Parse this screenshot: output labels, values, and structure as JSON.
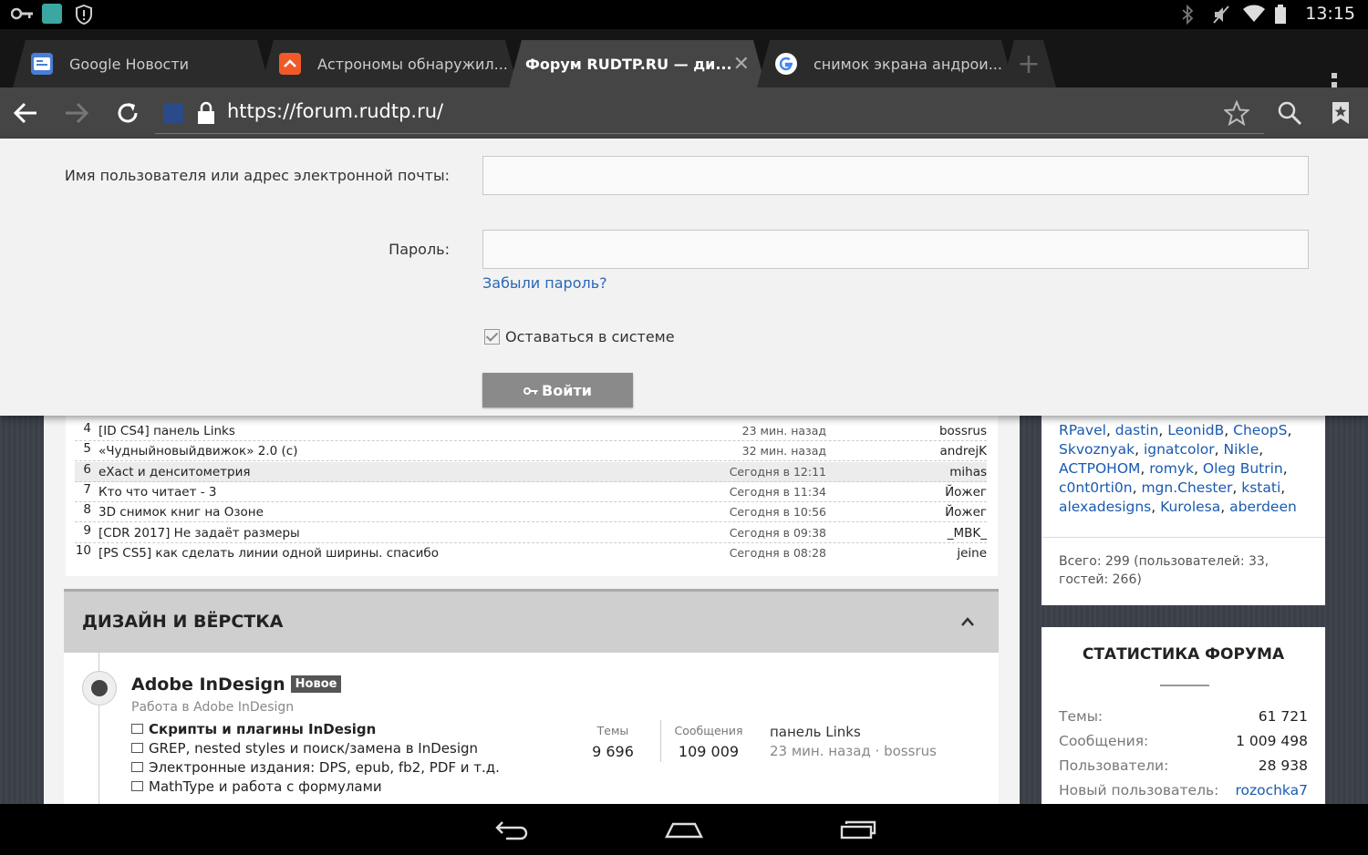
{
  "status_bar": {
    "time": "13:15",
    "left_icons": [
      "key-icon",
      "app-icon",
      "alert-icon"
    ],
    "right_icons": [
      "bluetooth-icon",
      "mute-icon",
      "wifi-icon",
      "battery-icon"
    ]
  },
  "tabs": [
    {
      "label": "Google Новости",
      "icon": "google-news-icon",
      "active": false
    },
    {
      "label": "Астрономы обнаружил...",
      "icon": "news-icon",
      "active": false
    },
    {
      "label": "Форум RUDTP.RU — ди...",
      "icon": "",
      "active": true
    },
    {
      "label": "снимок экрана андрои...",
      "icon": "google-icon",
      "active": false
    }
  ],
  "toolbar": {
    "url": "https://forum.rudtp.ru/"
  },
  "login": {
    "username_label": "Имя пользователя или адрес электронной почты:",
    "username_value": "",
    "password_label": "Пароль:",
    "password_value": "",
    "forgot_link": "Забыли пароль?",
    "remember_label": "Оставаться в системе",
    "remember_checked": true,
    "submit_label": "Войти"
  },
  "threads": [
    {
      "num": "4",
      "title": "[ID CS4]  панель Links",
      "time": "23 мин. назад",
      "user": "bossrus"
    },
    {
      "num": "5",
      "title": "«Чудныйновыйдвижок» 2.0 (с)",
      "time": "32 мин. назад",
      "user": "andrejK"
    },
    {
      "num": "6",
      "title": "eXact и денситометрия",
      "time": "Сегодня в 12:11",
      "user": "mihas"
    },
    {
      "num": "7",
      "title": "Кто что читает - 3",
      "time": "Сегодня в 11:34",
      "user": "Йожег"
    },
    {
      "num": "8",
      "title": "3D снимок книг на Озоне",
      "time": "Сегодня в 10:56",
      "user": "Йожег"
    },
    {
      "num": "9",
      "title": "[CDR 2017]  Не задаёт размеры",
      "time": "Сегодня в 09:38",
      "user": "_MBK_"
    },
    {
      "num": "10",
      "title": "[PS CS5]  как сделать линии одной ширины. спасибо",
      "time": "Сегодня в 08:28",
      "user": "jeine"
    }
  ],
  "section": {
    "title": "ДИЗАЙН И ВЁРСТКА"
  },
  "forum": {
    "title": "Adobe InDesign",
    "badge": "Новое",
    "description": "Работа в Adobe InDesign",
    "subforums": [
      "Скрипты и плагины InDesign",
      "GREP, nested styles и поиск/замена в InDesign",
      "Электронные издания: DPS, epub, fb2, PDF и т.д.",
      "MathType и работа с формулами"
    ],
    "threads_label": "Темы",
    "threads_value": "9 696",
    "posts_label": "Сообщения",
    "posts_value": "109 009",
    "last_title": "панель Links",
    "last_meta": "23 мин. назад · bossrus"
  },
  "online": {
    "users_line1": [
      "RPavel",
      "dastin",
      "LeonidB",
      "CheopS"
    ],
    "users_line2": [
      "Skvoznyak",
      "ignatcolor",
      "Nikle"
    ],
    "users_line3": [
      "ACTPOHOM",
      "romyk",
      "Oleg Butrin"
    ],
    "users_line4": [
      "c0nt0rti0n",
      "mgn.Chester",
      "kstati"
    ],
    "users_line5": [
      "alexadesigns",
      "Kurolesa",
      "aberdeen"
    ],
    "total": "Всего: 299 (пользователей: 33, гостей: 266)"
  },
  "stats": {
    "title": "СТАТИСТИКА ФОРУМА",
    "rows": [
      {
        "label": "Темы:",
        "value": "61 721"
      },
      {
        "label": "Сообщения:",
        "value": "1 009 498"
      },
      {
        "label": "Пользователи:",
        "value": "28 938"
      },
      {
        "label": "Новый пользователь:",
        "value": "rozochka7"
      }
    ]
  },
  "colors": {
    "accent_link": "#1a5ab0",
    "button_gray": "#8a8a8a"
  }
}
